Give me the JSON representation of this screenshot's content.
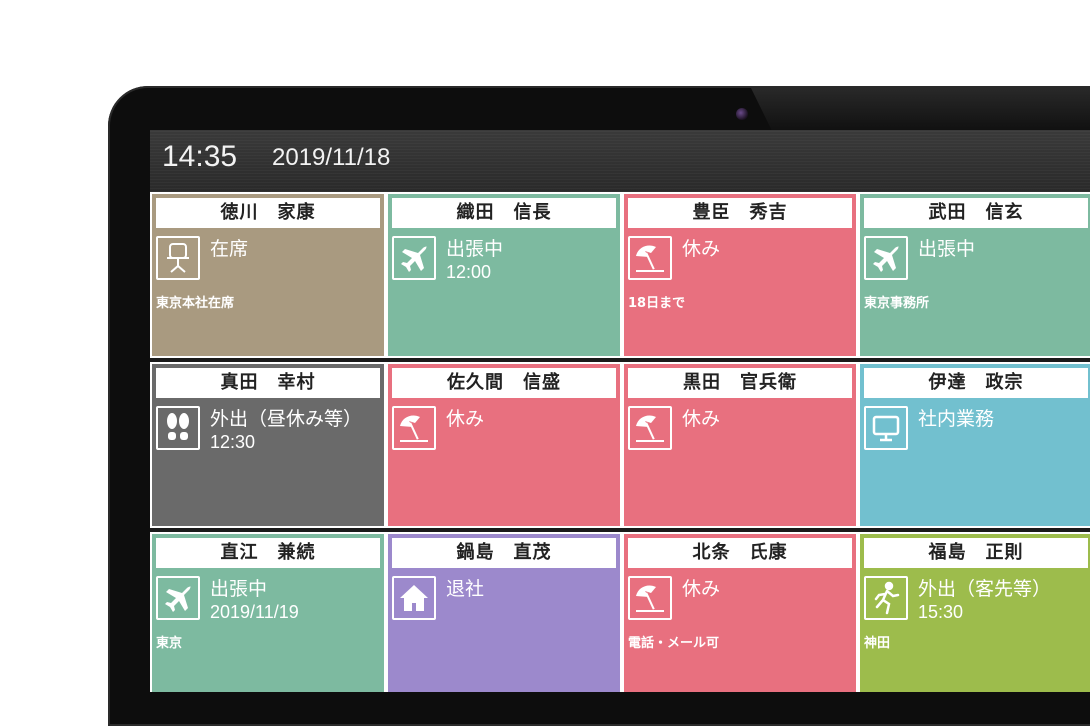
{
  "header": {
    "time": "14:35",
    "date": "2019/11/18"
  },
  "colors": {
    "present": "#A99A80",
    "business_trip": "#7DBAA0",
    "off": "#E8707F",
    "out_break": "#6A6A6A",
    "internal": "#72C0CF",
    "left_office": "#9C89CC",
    "out_client": "#9DBC4C"
  },
  "staff": [
    {
      "name": "徳川　家康",
      "status": "在席",
      "sub": "",
      "note": "東京本社在席",
      "icon": "chair-icon",
      "color": "#A99A80"
    },
    {
      "name": "織田　信長",
      "status": "出張中",
      "sub": "12:00",
      "note": "",
      "icon": "airplane-icon",
      "color": "#7DBAA0"
    },
    {
      "name": "豊臣　秀吉",
      "status": "休み",
      "sub": "",
      "note": "18日まで",
      "icon": "beach-umbrella-icon",
      "color": "#E8707F"
    },
    {
      "name": "武田　信玄",
      "status": "出張中",
      "sub": "",
      "note": "東京事務所",
      "icon": "airplane-icon",
      "color": "#7DBAA0"
    },
    {
      "name": "真田　幸村",
      "status": "外出（昼休み等）",
      "sub": "12:30",
      "note": "",
      "icon": "footprints-icon",
      "color": "#6A6A6A"
    },
    {
      "name": "佐久間　信盛",
      "status": "休み",
      "sub": "",
      "note": "",
      "icon": "beach-umbrella-icon",
      "color": "#E8707F"
    },
    {
      "name": "黒田　官兵衛",
      "status": "休み",
      "sub": "",
      "note": "",
      "icon": "beach-umbrella-icon",
      "color": "#E8707F"
    },
    {
      "name": "伊達　政宗",
      "status": "社内業務",
      "sub": "",
      "note": "",
      "icon": "monitor-icon",
      "color": "#72C0CF"
    },
    {
      "name": "直江　兼続",
      "status": "出張中",
      "sub": "2019/11/19",
      "note": "東京",
      "icon": "airplane-icon",
      "color": "#7DBAA0"
    },
    {
      "name": "鍋島　直茂",
      "status": "退社",
      "sub": "",
      "note": "",
      "icon": "home-icon",
      "color": "#9C89CC"
    },
    {
      "name": "北条　氏康",
      "status": "休み",
      "sub": "",
      "note": "電話・メール可",
      "icon": "beach-umbrella-icon",
      "color": "#E8707F"
    },
    {
      "name": "福島　正則",
      "status": "外出（客先等）",
      "sub": "15:30",
      "note": "神田",
      "icon": "running-person-icon",
      "color": "#9DBC4C"
    }
  ]
}
